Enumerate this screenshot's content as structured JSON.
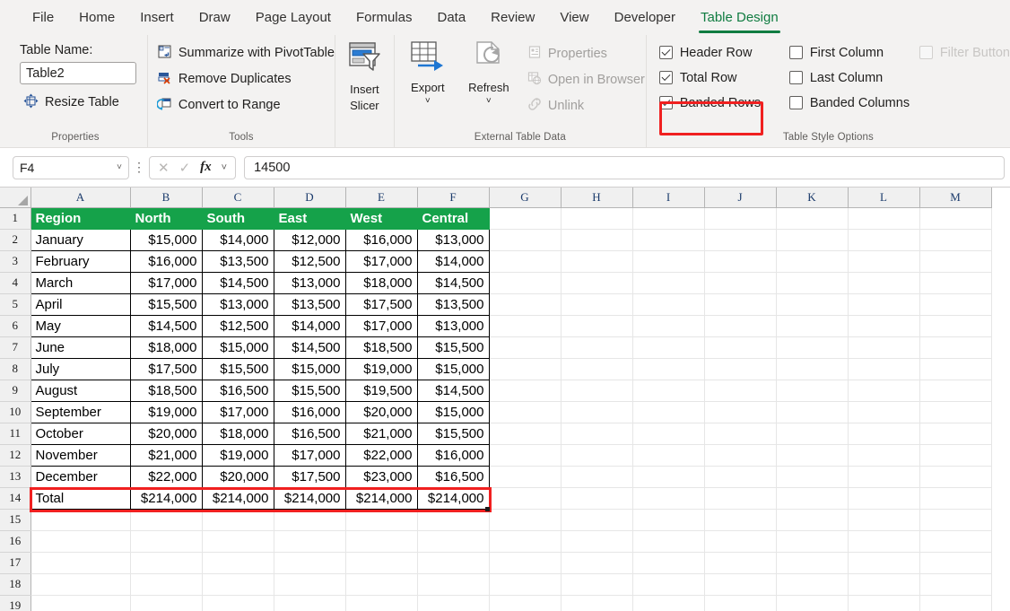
{
  "ribbon_tabs": [
    {
      "label": "File",
      "active": false
    },
    {
      "label": "Home",
      "active": false
    },
    {
      "label": "Insert",
      "active": false
    },
    {
      "label": "Draw",
      "active": false
    },
    {
      "label": "Page Layout",
      "active": false
    },
    {
      "label": "Formulas",
      "active": false
    },
    {
      "label": "Data",
      "active": false
    },
    {
      "label": "Review",
      "active": false
    },
    {
      "label": "View",
      "active": false
    },
    {
      "label": "Developer",
      "active": false
    },
    {
      "label": "Table Design",
      "active": true
    }
  ],
  "groups": {
    "properties": {
      "caption": "Properties",
      "table_name_label": "Table Name:",
      "table_name_value": "Table2",
      "resize_table": "Resize Table"
    },
    "tools": {
      "caption": "Tools",
      "items": [
        "Summarize with PivotTable",
        "Remove Duplicates",
        "Convert to Range"
      ]
    },
    "slicer": {
      "insert_slicer_line1": "Insert",
      "insert_slicer_line2": "Slicer"
    },
    "external": {
      "caption": "External Table Data",
      "export": "Export",
      "refresh": "Refresh",
      "properties": "Properties",
      "open_in_browser": "Open in Browser",
      "unlink": "Unlink"
    },
    "table_style_options": {
      "caption": "Table Style Options",
      "column1": [
        {
          "label": "Header Row",
          "checked": true,
          "disabled": false,
          "highlighted": false
        },
        {
          "label": "Total Row",
          "checked": true,
          "disabled": false,
          "highlighted": true
        },
        {
          "label": "Banded Rows",
          "checked": true,
          "disabled": false,
          "highlighted": false
        }
      ],
      "column2": [
        {
          "label": "First Column",
          "checked": false,
          "disabled": false,
          "highlighted": false
        },
        {
          "label": "Last Column",
          "checked": false,
          "disabled": false,
          "highlighted": false
        },
        {
          "label": "Banded Columns",
          "checked": false,
          "disabled": false,
          "highlighted": false
        }
      ],
      "column3": [
        {
          "label": "Filter Button",
          "checked": false,
          "disabled": true,
          "highlighted": false
        }
      ]
    }
  },
  "formula_bar": {
    "name_box_value": "F4",
    "formula_value": "14500",
    "cancel_icon": "✕",
    "enter_icon": "✓",
    "fx_label": "fx"
  },
  "grid": {
    "column_headers": [
      "A",
      "B",
      "C",
      "D",
      "E",
      "F",
      "G",
      "H",
      "I",
      "J",
      "K",
      "L",
      "M"
    ],
    "row_numbers": [
      1,
      2,
      3,
      4,
      5,
      6,
      7,
      8,
      9,
      10,
      11,
      12,
      13,
      14,
      15,
      16,
      17,
      18,
      19
    ],
    "accent_green": "#15a24a",
    "highlight_red": "#f02020"
  },
  "chart_data": {
    "type": "table",
    "title": "Table2",
    "headers": [
      "Region",
      "North",
      "South",
      "East",
      "West",
      "Central"
    ],
    "rows": [
      [
        "January",
        "$15,000",
        "$14,000",
        "$12,000",
        "$16,000",
        "$13,000"
      ],
      [
        "February",
        "$16,000",
        "$13,500",
        "$12,500",
        "$17,000",
        "$14,000"
      ],
      [
        "March",
        "$17,000",
        "$14,500",
        "$13,000",
        "$18,000",
        "$14,500"
      ],
      [
        "April",
        "$15,500",
        "$13,000",
        "$13,500",
        "$17,500",
        "$13,500"
      ],
      [
        "May",
        "$14,500",
        "$12,500",
        "$14,000",
        "$17,000",
        "$13,000"
      ],
      [
        "June",
        "$18,000",
        "$15,000",
        "$14,500",
        "$18,500",
        "$15,500"
      ],
      [
        "July",
        "$17,500",
        "$15,500",
        "$15,000",
        "$19,000",
        "$15,000"
      ],
      [
        "August",
        "$18,500",
        "$16,500",
        "$15,500",
        "$19,500",
        "$14,500"
      ],
      [
        "September",
        "$19,000",
        "$17,000",
        "$16,000",
        "$20,000",
        "$15,000"
      ],
      [
        "October",
        "$20,000",
        "$18,000",
        "$16,500",
        "$21,000",
        "$15,500"
      ],
      [
        "November",
        "$21,000",
        "$19,000",
        "$17,000",
        "$22,000",
        "$16,000"
      ],
      [
        "December",
        "$22,000",
        "$20,000",
        "$17,500",
        "$23,000",
        "$16,500"
      ]
    ],
    "total_row": [
      "Total",
      "$214,000",
      "$214,000",
      "$214,000",
      "$214,000",
      "$214,000"
    ]
  }
}
